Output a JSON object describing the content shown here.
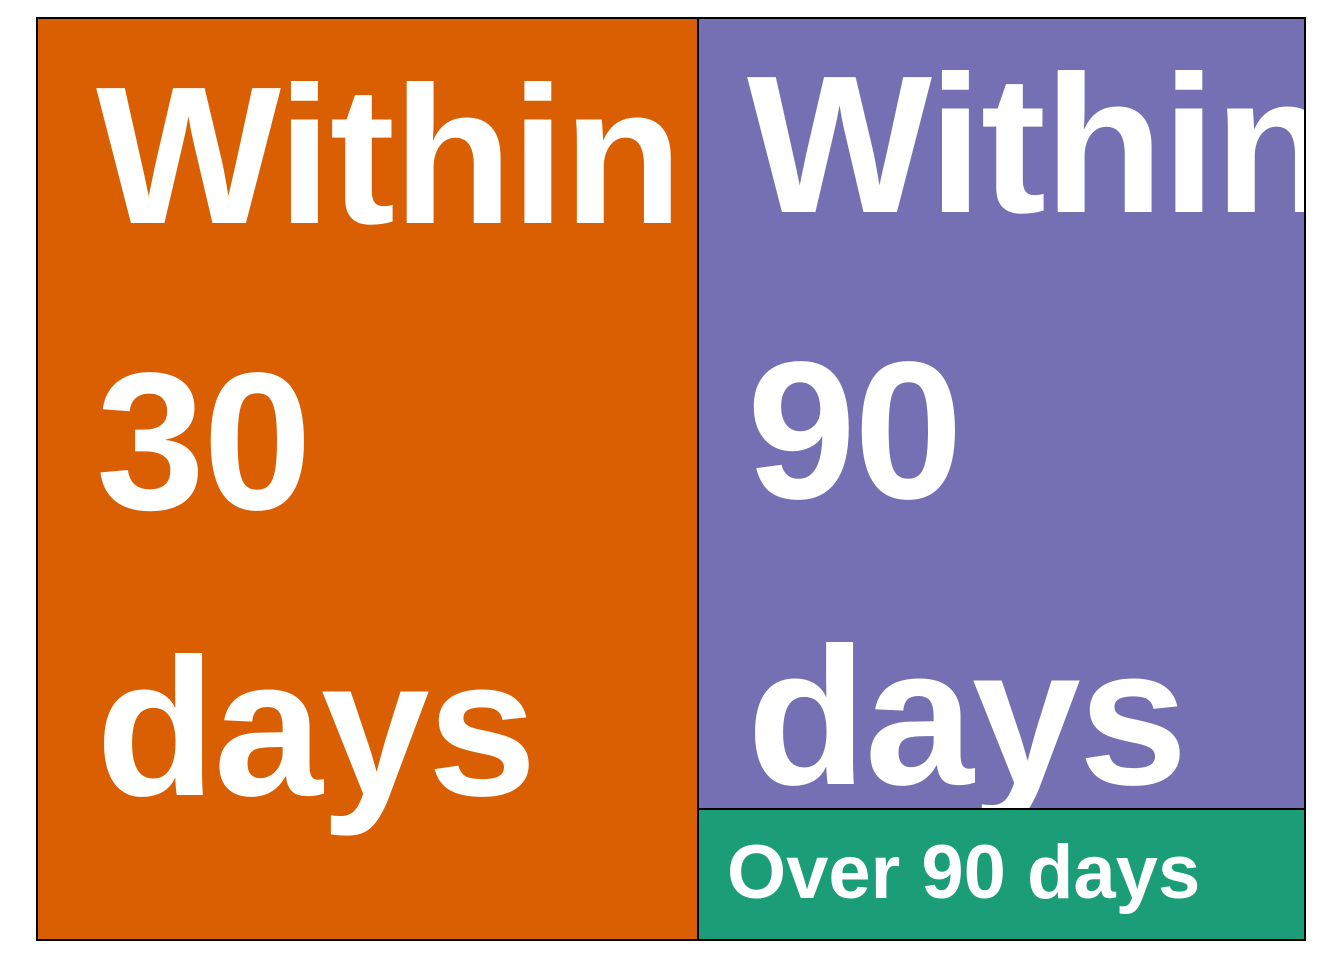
{
  "chart_data": {
    "type": "treemap",
    "tiles": [
      {
        "key": "within_30",
        "label_lines": [
          "Within",
          "30",
          "days"
        ],
        "color": "#d95f02"
      },
      {
        "key": "within_90",
        "label_lines": [
          "Within",
          "90",
          "days"
        ],
        "color": "#7570b3"
      },
      {
        "key": "over_90",
        "label": "Over 90 days",
        "color": "#1b9e77"
      }
    ]
  }
}
